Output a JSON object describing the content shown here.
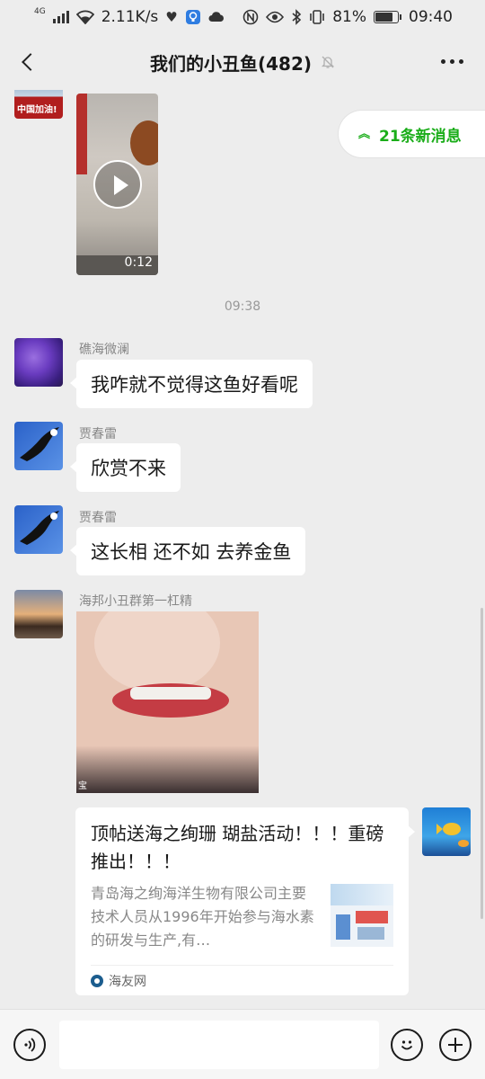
{
  "status_bar": {
    "network": "4G",
    "speed": "2.11K/s",
    "battery": "81%",
    "battery_level": 0.81,
    "time": "09:40"
  },
  "header": {
    "title": "我们的小丑鱼(482)"
  },
  "new_messages": {
    "label": "21条新消息"
  },
  "messages": [
    {
      "type": "video",
      "duration": "0:12",
      "avatar_text": "中国加油!"
    },
    {
      "type": "time",
      "text": "09:38"
    },
    {
      "type": "text",
      "sender": "礁海微澜",
      "text": "我咋就不觉得这鱼好看呢"
    },
    {
      "type": "text",
      "sender": "贾春雷",
      "text": "欣赏不来"
    },
    {
      "type": "text",
      "sender": "贾春雷",
      "text": "这长相 还不如 去养金鱼"
    },
    {
      "type": "image",
      "sender": "海邦小丑群第一杠精",
      "watermark": "宝"
    },
    {
      "type": "link",
      "title": "顶帖送海之绚珊 瑚盐活动！！！重磅推出！！！",
      "desc": "青岛海之绚海洋生物有限公司主要技术人员从1996年开始参与海水素的研发与生产,有…",
      "source": "海友网"
    }
  ],
  "input": {
    "value": ""
  }
}
